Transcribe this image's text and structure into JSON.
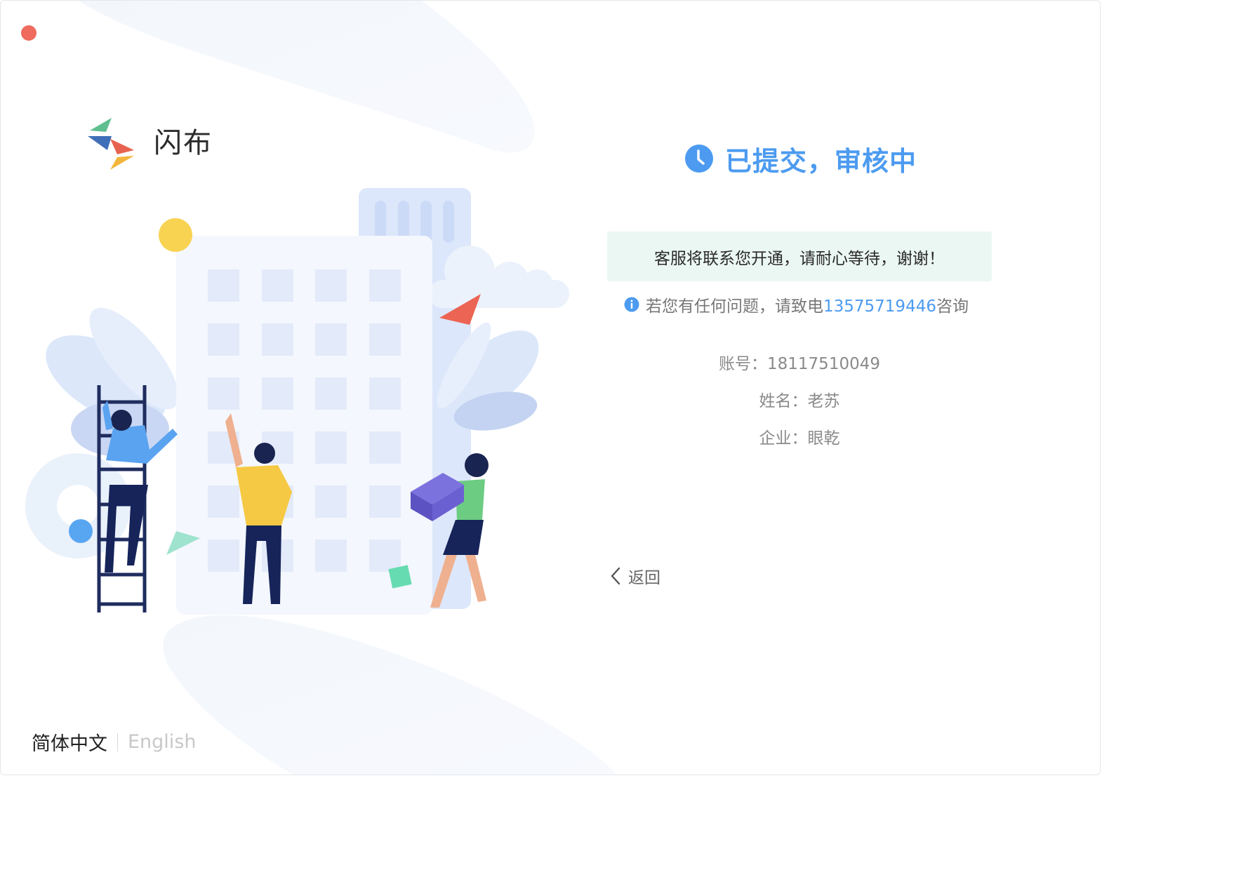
{
  "app": {
    "logo_text": "闪布"
  },
  "status": {
    "title": "已提交，审核中",
    "notice": "客服将联系您开通，请耐心等待，谢谢！",
    "contact_prefix": "若您有任何问题，请致电",
    "contact_phone": "13575719446",
    "contact_suffix": "咨询"
  },
  "fields": [
    {
      "text": "账号：18117510049"
    },
    {
      "text": "姓名：老苏"
    },
    {
      "text": "企业：眼乾"
    }
  ],
  "back_label": "返回",
  "language": {
    "chinese": "简体中文",
    "english": "English",
    "active": "简体中文"
  },
  "colors": {
    "accent": "#4c9bf0",
    "notice_bg": "#ebf7f3",
    "close_dot": "#ee6b5d"
  },
  "icons": {
    "status": "clock-icon",
    "contact": "info-icon",
    "back": "chevron-left-icon"
  }
}
